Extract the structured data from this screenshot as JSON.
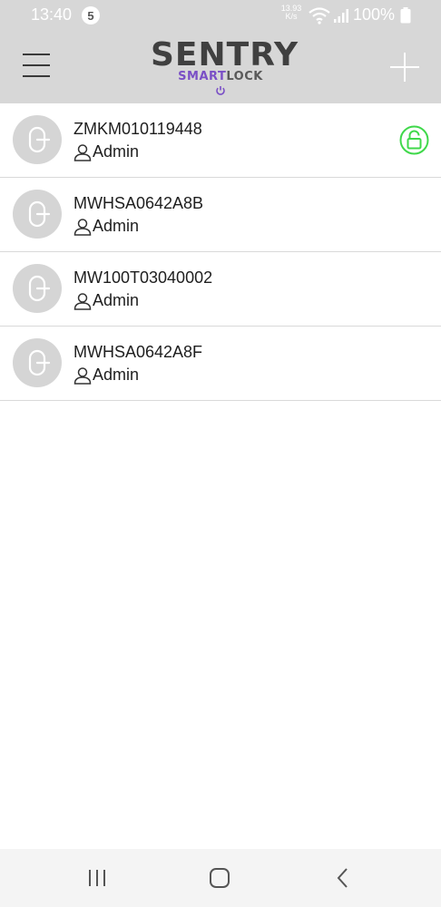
{
  "status_bar": {
    "time": "13:40",
    "notification_count": "5",
    "net_speed_value": "13.93",
    "net_speed_unit": "K/s",
    "battery": "100%"
  },
  "header": {
    "logo_title": "SENTRY",
    "logo_sub_smart": "SMART",
    "logo_sub_lock": "LOCK"
  },
  "locks": [
    {
      "name": "ZMKM010119448",
      "role": "Admin",
      "unlocked_indicator": true
    },
    {
      "name": "MWHSA0642A8B",
      "role": "Admin",
      "unlocked_indicator": false
    },
    {
      "name": "MW100T03040002",
      "role": "Admin",
      "unlocked_indicator": false
    },
    {
      "name": "MWHSA0642A8F",
      "role": "Admin",
      "unlocked_indicator": false
    }
  ],
  "colors": {
    "header_bg": "#d7d7d7",
    "accent_purple": "#7a4fc6",
    "unlock_green": "#3fd84a",
    "avatar_bg": "#d5d5d5"
  },
  "icons": {
    "menu": "hamburger-menu-icon",
    "add": "plus-icon",
    "lock_avatar": "door-handle-icon",
    "role": "user-icon",
    "status": "open-padlock-icon"
  }
}
